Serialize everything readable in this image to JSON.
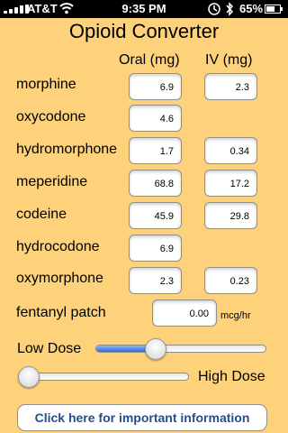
{
  "status_bar": {
    "carrier": "AT&T",
    "time": "9:35 PM",
    "battery_pct": "65%",
    "signal_bars": 5,
    "battery_level": 0.65,
    "icons": [
      "signal-bars-icon",
      "wifi-icon",
      "lock-icon",
      "bluetooth-icon",
      "battery-icon"
    ]
  },
  "title": "Opioid Converter",
  "columns": {
    "oral": "Oral (mg)",
    "iv": "IV (mg)"
  },
  "drugs": [
    {
      "name": "morphine",
      "oral": "6.9",
      "iv": "2.3"
    },
    {
      "name": "oxycodone",
      "oral": "4.6"
    },
    {
      "name": "hydromorphone",
      "oral": "1.7",
      "iv": "0.34"
    },
    {
      "name": "meperidine",
      "oral": "68.8",
      "iv": "17.2"
    },
    {
      "name": "codeine",
      "oral": "45.9",
      "iv": "29.8"
    },
    {
      "name": "hydrocodone",
      "oral": "6.9"
    },
    {
      "name": "oxymorphone",
      "oral": "2.3",
      "iv": "0.23"
    }
  ],
  "fentanyl": {
    "name": "fentanyl patch",
    "value": "0.00",
    "unit": "mcg/hr"
  },
  "dose_slider": {
    "low_label": "Low Dose",
    "value": 0.33
  },
  "high_slider": {
    "label": "High Dose",
    "value": 0.0
  },
  "info_button": "Click here for important information",
  "colors": {
    "background": "#fdd27a",
    "slider_fill": "#2c6fdc",
    "button_text": "#234f8f"
  }
}
